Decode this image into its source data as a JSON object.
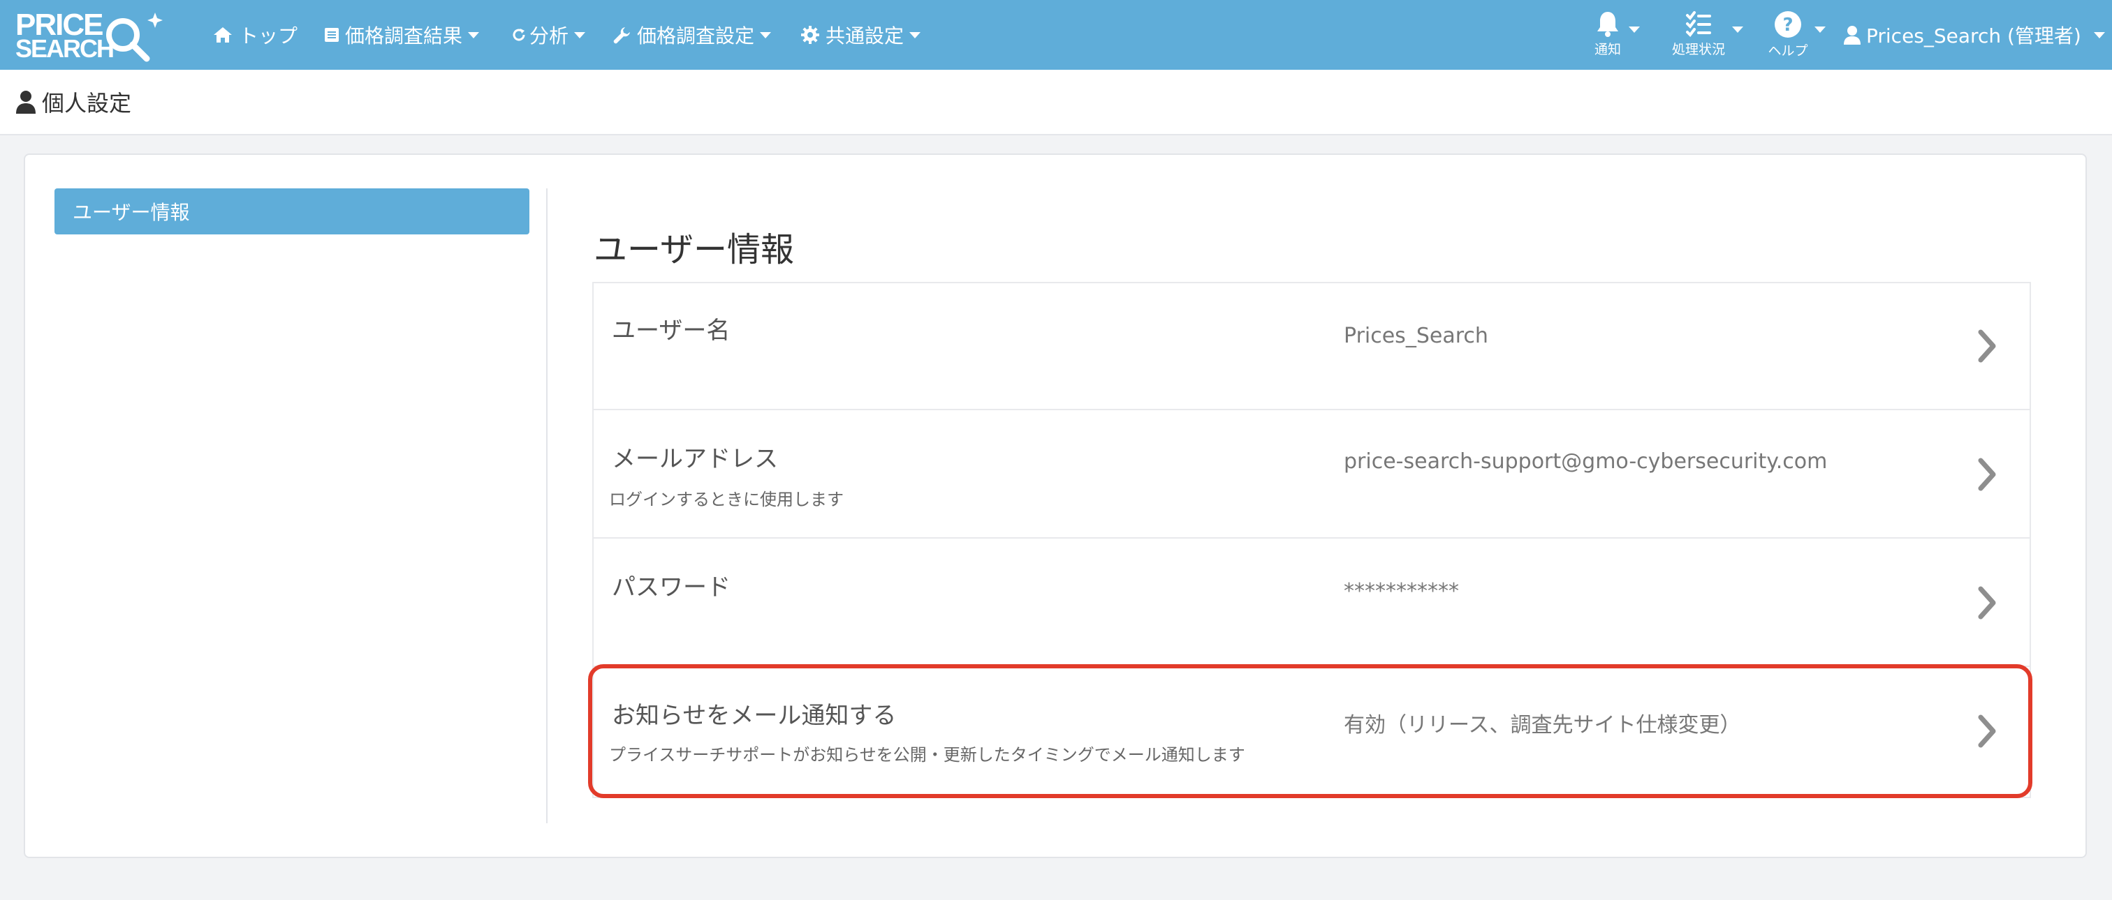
{
  "app": {
    "logo_line1": "PRICE",
    "logo_line2": "SEARCH"
  },
  "nav": {
    "items": [
      {
        "label": "トップ",
        "icon": "home-icon"
      },
      {
        "label": "価格調査結果",
        "icon": "list-icon"
      },
      {
        "label": "分析",
        "icon": "refresh-icon"
      },
      {
        "label": "価格調査設定",
        "icon": "wrench-icon"
      },
      {
        "label": "共通設定",
        "icon": "gear-icon"
      }
    ],
    "right": {
      "notify_label": "通知",
      "status_label": "処理状況",
      "help_label": "ヘルプ",
      "user_label": "Prices_Search (管理者)"
    }
  },
  "page": {
    "title": "個人設定"
  },
  "sidebar": {
    "items": [
      {
        "label": "ユーザー情報",
        "active": true
      }
    ]
  },
  "main": {
    "section_title": "ユーザー情報",
    "rows": [
      {
        "label": "ユーザー名",
        "description": "",
        "value": "Prices_Search"
      },
      {
        "label": "メールアドレス",
        "description": "ログインするときに使用します",
        "value": "price-search-support@gmo-cybersecurity.com"
      },
      {
        "label": "パスワード",
        "description": "",
        "value": "***********"
      },
      {
        "label": "お知らせをメール通知する",
        "description": "プライスサーチサポートがお知らせを公開・更新したタイミングでメール通知します",
        "value": "有効（リリース、調査先サイト仕様変更）"
      }
    ]
  },
  "colors": {
    "nav_bg": "#5fadd9",
    "highlight": "#e23b2a",
    "page_bg": "#f2f3f5"
  }
}
